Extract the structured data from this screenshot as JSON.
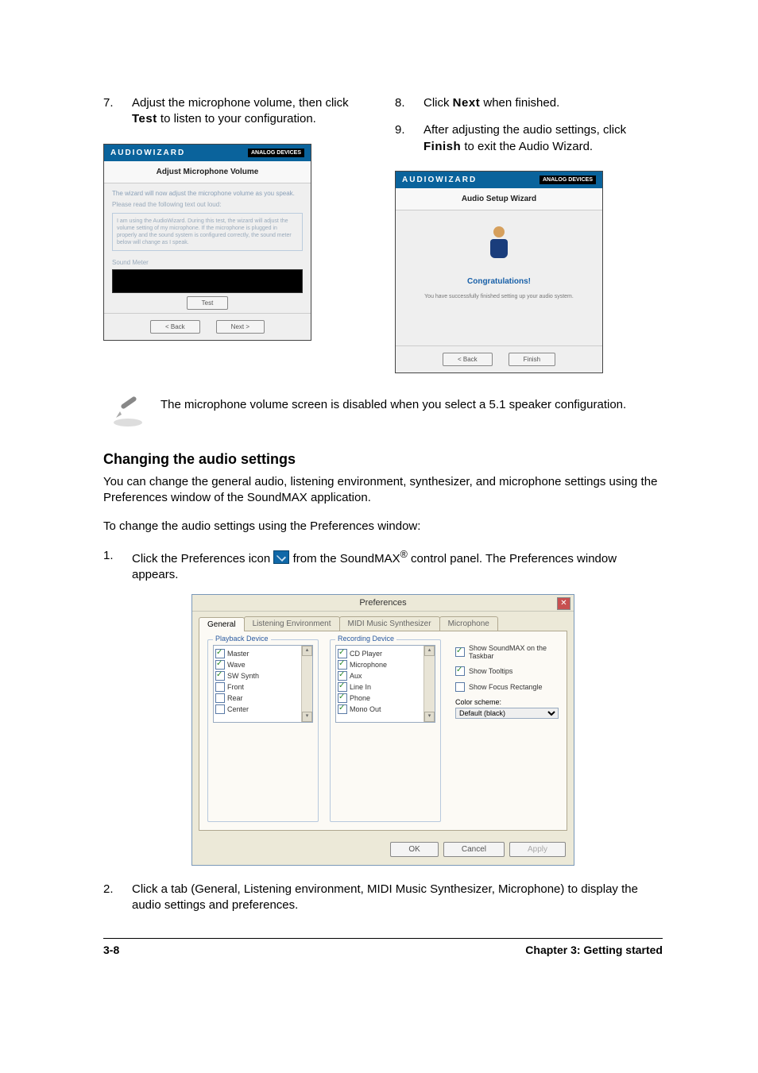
{
  "steps_left": [
    {
      "num": "7.",
      "pre": "Adjust the microphone volume, then click ",
      "bold": "Test",
      "post": " to listen to your configuration."
    }
  ],
  "steps_right": [
    {
      "num": "8.",
      "pre": "Click ",
      "bold": "Next",
      "post": " when finished."
    },
    {
      "num": "9.",
      "pre": "After adjusting the audio settings, click ",
      "bold": "Finish",
      "post": " to exit the Audio Wizard."
    }
  ],
  "wizard_left": {
    "titlebar": "AUDIOWIZARD",
    "logo": "ANALOG DEVICES",
    "section_head": "Adjust Microphone Volume",
    "line1": "The wizard will now adjust the microphone volume as you speak.",
    "line2": "Please read the following text out loud:",
    "box_text": "I am using the AudioWizard. During this test, the wizard will adjust the volume setting of my microphone. If the microphone is plugged in properly and the sound system is configured correctly, the sound meter below will change as I speak.",
    "meter_label": "Sound Meter",
    "test_btn": "Test",
    "back_btn": "< Back",
    "next_btn": "Next >"
  },
  "wizard_right": {
    "titlebar": "AUDIOWIZARD",
    "logo": "ANALOG DEVICES",
    "section_head": "Audio Setup Wizard",
    "congrats": "Congratulations!",
    "sub": "You have successfully finished setting up your audio system.",
    "back_btn": "< Back",
    "finish_btn": "Finish"
  },
  "note": "The microphone volume screen is disabled when you select a 5.1 speaker configuration.",
  "section_heading": "Changing the audio settings",
  "para1": "You can change the general audio, listening environment, synthesizer, and microphone settings using the Preferences window of the SoundMAX application.",
  "para2": "To change the audio settings using the Preferences window:",
  "num_steps": [
    {
      "num": "1.",
      "pre": "Click the Preferences icon ",
      "post1": " from the SoundMAX",
      "reg": "®",
      "post2": " control panel. The Preferences window appears."
    },
    {
      "num": "2.",
      "text": "Click a tab (General, Listening environment, MIDI Music Synthesizer, Microphone) to display the audio settings and preferences."
    }
  ],
  "prefs": {
    "title": "Preferences",
    "tabs": [
      "General",
      "Listening Environment",
      "MIDI Music Synthesizer",
      "Microphone"
    ],
    "playback_legend": "Playback Device",
    "playback_items": [
      {
        "label": "Master",
        "checked": true
      },
      {
        "label": "Wave",
        "checked": true
      },
      {
        "label": "SW Synth",
        "checked": true
      },
      {
        "label": "Front",
        "checked": false
      },
      {
        "label": "Rear",
        "checked": false
      },
      {
        "label": "Center",
        "checked": false
      }
    ],
    "recording_legend": "Recording Device",
    "recording_items": [
      {
        "label": "CD Player",
        "checked": true
      },
      {
        "label": "Microphone",
        "checked": true
      },
      {
        "label": "Aux",
        "checked": true
      },
      {
        "label": "Line In",
        "checked": true
      },
      {
        "label": "Phone",
        "checked": true
      },
      {
        "label": "Mono Out",
        "checked": true
      }
    ],
    "right_opts": [
      {
        "label": "Show SoundMAX on the Taskbar",
        "checked": true
      },
      {
        "label": "Show Tooltips",
        "checked": true
      },
      {
        "label": "Show Focus Rectangle",
        "checked": false
      }
    ],
    "color_label": "Color scheme:",
    "color_value": "Default (black)",
    "ok": "OK",
    "cancel": "Cancel",
    "apply": "Apply"
  },
  "footer_left": "3-8",
  "footer_right": "Chapter 3: Getting started"
}
